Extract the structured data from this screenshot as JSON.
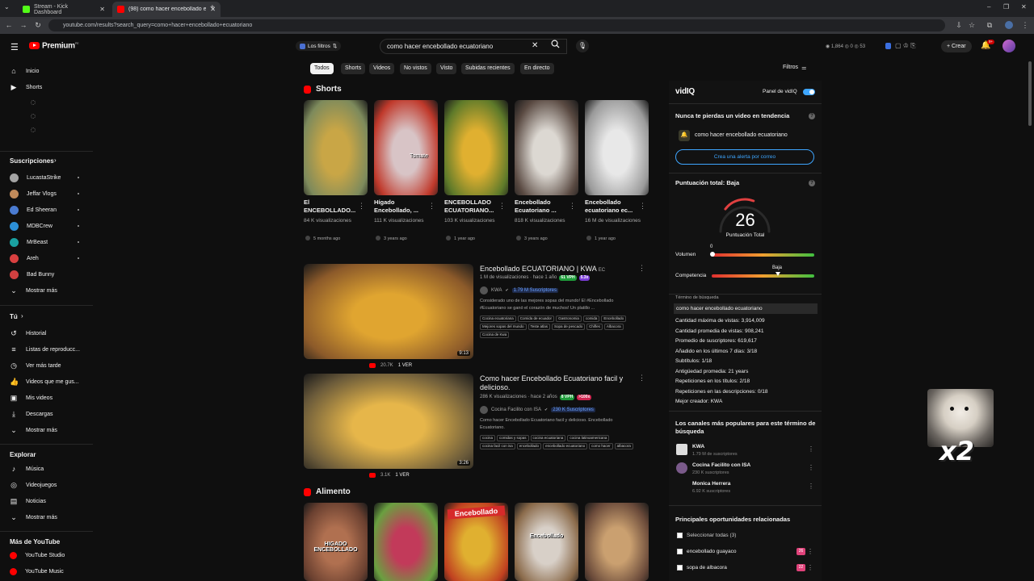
{
  "browser": {
    "tabs": [
      {
        "title": "Stream - Kick Dashboard",
        "favicon_color": "#53fc18"
      },
      {
        "title": "(98) como hacer encebollado ecuatoriano",
        "favicon_color": "#ff0000"
      }
    ],
    "url": "youtube.com/results?search_query=como+hacer+encebollado+ecuatoriano"
  },
  "header": {
    "brand": "Premium",
    "brand_sup": "PE",
    "filters_label": "Los filtros",
    "search_value": "como hacer encebollado ecuatoriano",
    "stats": "1,864  ◎ 0  ◎ 53",
    "create_label": "Crear",
    "notif_badge": "9+"
  },
  "chips": [
    "Todos",
    "Shorts",
    "Videos",
    "No vistos",
    "Visto",
    "Subidas recientes",
    "En directo"
  ],
  "filters_label": "Filtros",
  "sidebar": {
    "main": [
      {
        "label": "Inicio",
        "icon": "home-icon"
      },
      {
        "label": "Shorts",
        "icon": "shorts-icon"
      }
    ],
    "subs_heading": "Suscripciones",
    "subs": [
      {
        "label": "LucastaStrike",
        "color": "#a3a3a3"
      },
      {
        "label": "Jeffar Vlogs",
        "color": "#c08a5a"
      },
      {
        "label": "Ed Sheeran",
        "color": "#4a7bd1"
      },
      {
        "label": "MDBCrew",
        "color": "#2c8fd6"
      },
      {
        "label": "MrBeast",
        "color": "#1aa1a1"
      },
      {
        "label": "Areh",
        "color": "#d94040"
      },
      {
        "label": "Bad Bunny",
        "color": "#d04040"
      },
      {
        "label": "Mostrar más",
        "color": ""
      }
    ],
    "you_heading": "Tú",
    "you": [
      {
        "label": "Historial",
        "icon": "history-icon"
      },
      {
        "label": "Listas de reproducc...",
        "icon": "playlist-icon"
      },
      {
        "label": "Ver más tarde",
        "icon": "clock-icon"
      },
      {
        "label": "Videos que me gus...",
        "icon": "thumbs-up-icon"
      },
      {
        "label": "Mis videos",
        "icon": "video-icon"
      },
      {
        "label": "Descargas",
        "icon": "download-icon"
      },
      {
        "label": "Mostrar más",
        "icon": "chevron-down-icon"
      }
    ],
    "explore_heading": "Explorar",
    "explore": [
      {
        "label": "Música",
        "icon": "music-icon"
      },
      {
        "label": "Videojuegos",
        "icon": "gamepad-icon"
      },
      {
        "label": "Noticias",
        "icon": "news-icon"
      },
      {
        "label": "Mostrar más",
        "icon": "chevron-down-icon"
      }
    ],
    "more_heading": "Más de YouTube",
    "more": [
      {
        "label": "YouTube Studio"
      },
      {
        "label": "YouTube Music"
      }
    ]
  },
  "shorts_heading": "Shorts",
  "shorts": [
    {
      "title": "El ENCEBOLLADO...",
      "views": "84 K visualizaciones",
      "age": "5 months ago",
      "c1": "#c9a646",
      "c2": "#7d8a5c",
      "text": ""
    },
    {
      "title": "Hígado Encebollado, ...",
      "views": "111 K visualizaciones",
      "age": "3 years ago",
      "c1": "#d8c4c6",
      "c2": "#c0392b",
      "text": "Tomate"
    },
    {
      "title": "ENCEBOLLADO ECUATORIANO...",
      "views": "103 K visualizaciones",
      "age": "1 year ago",
      "c1": "#e0b030",
      "c2": "#5e7a2a",
      "text": ""
    },
    {
      "title": "Encebollado Ecuatoriano ...",
      "views": "818 K visualizaciones",
      "age": "3 years ago",
      "c1": "#dcd8d2",
      "c2": "#5a4a42",
      "text": ""
    },
    {
      "title": "Encebollado ecuatoriano ec...",
      "views": "16 M de visualizaciones",
      "age": "1 year ago",
      "c1": "#e8e8e8",
      "c2": "#9a9a9a",
      "text": ""
    }
  ],
  "videos": [
    {
      "title": "Encebollado ECUATORIANO | KWA ",
      "title_suffix": "EC",
      "meta": "1 M de visualizaciones · hace 1 año",
      "vph": "61 VPH",
      "vph_color": "#1e9c3a",
      "ratio": "5.3x",
      "ratio_color": "#7a3cd6",
      "channel": "KWA",
      "subs": "1.79 M Suscriptores",
      "desc": "Considerado uno de las mejores sopas del mundo! El #Encebollado #Ecuatoriano se ganó el corazón de muchos! Un platillo ...",
      "tags": [
        "Cocina ecuatoriana",
        "Comida de ecuador",
        "Gastronomia",
        "comida",
        "Encebollado",
        "Mejores sopas del mundo",
        "Teste atlas",
        "Sopa de pescado",
        "Chifles",
        "Albacora",
        "Cocina de Kwa"
      ],
      "duration": "9:13",
      "stat1": "20.7K",
      "stat2": "1 VER",
      "c1": "#e0a530",
      "c2": "#8c5a2a"
    },
    {
      "title": "Como hacer Encebollado Ecuatoriano facil y delicioso.",
      "title_suffix": "",
      "meta": "286 K visualizaciones · hace 2 años",
      "vph": "8 VPH",
      "vph_color": "#1e9c3a",
      "ratio": ">100x",
      "ratio_color": "#d0244f",
      "channel": "Cocina Facilito con ISA",
      "subs": "230 K Suscriptores",
      "desc": "Como hacer Encebollado Ecuatoriano facil y delicioso. Encebollado Ecuatoriano.",
      "tags": [
        "cocina",
        "comidas y sopas",
        "cocina ecuatoriana",
        "cocina latinoamericana",
        "cocina facil con isa",
        "encebollado",
        "encebollado ecuatoriano",
        "como hacer",
        "albacora"
      ],
      "duration": "3:26",
      "stat1": "3.1K",
      "stat2": "1 VER",
      "c1": "#e6b64a",
      "c2": "#6a5a3a"
    }
  ],
  "alimento_heading": "Alimento",
  "alimento": [
    {
      "c1": "#b07050",
      "c2": "#6a4030",
      "text": "HIGADO ENCEBOLLADO"
    },
    {
      "c1": "#c23a5a",
      "c2": "#6aa040",
      "text": ""
    },
    {
      "c1": "#e0b030",
      "c2": "#c04020",
      "text": "Encebollado"
    },
    {
      "c1": "#d8d0c8",
      "c2": "#8a6a4a",
      "text": "Encebollado"
    },
    {
      "c1": "#caa070",
      "c2": "#6a4a3a",
      "text": ""
    }
  ],
  "vidiq": {
    "brand": "vidIQ",
    "panel_label": "Panel de vidIQ",
    "trend_title": "Nunca te pierdas un video en tendencia",
    "trend_keyword": "como hacer encebollado ecuatoriano",
    "alert_button": "Crea una alerta por correo",
    "score_title": "Puntuación total: Baja",
    "score": "26",
    "score_label": "Puntuación Total",
    "score_fraction": 0.26,
    "volume_label": "Volumen",
    "volume_value": "0",
    "competition_label": "Competencia",
    "competition_value": "Baja",
    "term_label": "Término de búsqueda",
    "term_value": "como hacer encebollado ecuatoriano",
    "stats": [
      "Cantidad máxima de vistas: 3,914,009",
      "Cantidad promedia de vistas: 908,241",
      "Promedio de suscriptores: 619,617",
      "Añadido en los últimos 7 días: 3/18",
      "Subtítulos: 1/18",
      "Antigüedad promedia: 21 years",
      "Repeticiones en los títulos: 2/18",
      "Repeticiones en las descripciones: 0/18",
      "Mejor creador: KWA"
    ],
    "channels_title": "Los canales más populares para este término de búsqueda",
    "channels": [
      {
        "name": "KWA",
        "subs": "1.79 M de suscriptores"
      },
      {
        "name": "Cocina Facilito con ISA",
        "subs": "230 K suscriptores"
      },
      {
        "name": "Monica Herrera",
        "subs": "6.92 K suscriptores"
      }
    ],
    "opps_title": "Principales oportunidades relacionadas",
    "select_all": "Seleccionar todas (3)",
    "opps": [
      {
        "label": "encebollado guayaco",
        "score": "26"
      },
      {
        "label": "sopa de albacora",
        "score": "22"
      }
    ]
  },
  "overlay": {
    "text": "x2"
  }
}
